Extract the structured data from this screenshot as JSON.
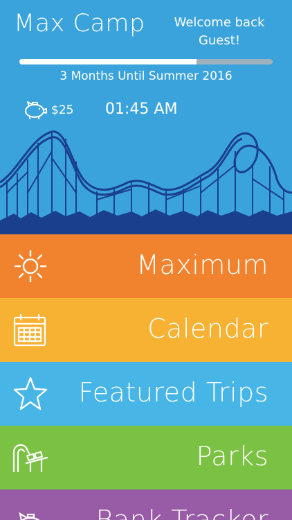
{
  "header": {
    "app_title": "Max Camp",
    "welcome_line1": "Welcome back",
    "welcome_line2": "Guest!",
    "progress_fraction": 0.7,
    "countdown": "3 Months Until Summer 2016",
    "money_icon": "piggy-bank-icon",
    "money": "$25",
    "clock": "01:45 AM"
  },
  "menu": {
    "items": [
      {
        "label": "Maximum",
        "icon": "sun-icon",
        "color": "#f2832e"
      },
      {
        "label": "Calendar",
        "icon": "calendar-icon",
        "color": "#f7b233"
      },
      {
        "label": "Featured Trips",
        "icon": "star-icon",
        "color": "#47b5e6"
      },
      {
        "label": "Parks",
        "icon": "roller-coaster-icon",
        "color": "#7bc144"
      },
      {
        "label": "Bank Tracker",
        "icon": "piggy-bank-icon",
        "color": "#985ba6"
      }
    ]
  }
}
